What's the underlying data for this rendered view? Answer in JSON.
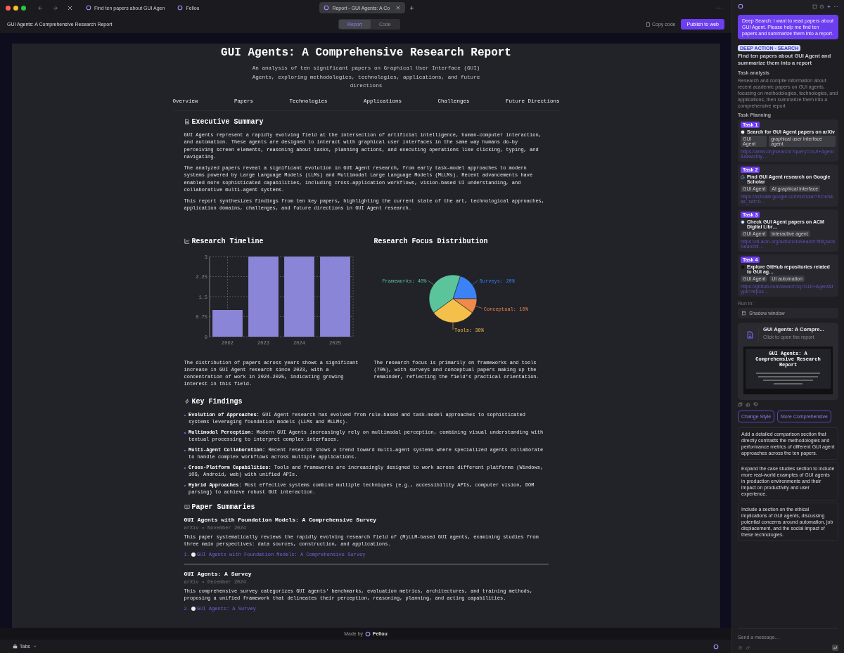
{
  "browser": {
    "tabs": [
      {
        "title": "Find ten papers about GUI Agen",
        "selected": false
      },
      {
        "title": "Fellou",
        "selected": false
      },
      {
        "title": "Report - GUI Agents: A Co",
        "selected": true
      }
    ],
    "new_tab": "+",
    "more": "···"
  },
  "toolbar": {
    "title": "GUI Agents: A Comprehensive Research Report",
    "views": [
      {
        "label": "Report",
        "selected": true
      },
      {
        "label": "Code",
        "selected": false
      }
    ],
    "copy": "Copy code",
    "publish": "Publish to web"
  },
  "report": {
    "title": "GUI Agents: A Comprehensive Research Report",
    "subtitle": "An analysis of ten significant papers on Graphical User Interface (GUI) Agents, exploring methodologies, technologies, applications, and future directions",
    "nav": [
      "Overview",
      "Papers",
      "Technologies",
      "Applications",
      "Challenges",
      "Future Directions"
    ],
    "summary": {
      "heading": "Executive Summary",
      "paragraphs": [
        "GUI Agents represent a rapidly evolving field at the intersection of artificial intelligence, human-computer interaction, and automation. These agents are designed to interact with graphical user interfaces in the same way humans do-by perceiving screen elements, reasoning about tasks, planning actions, and executing operations like clicking, typing, and navigating.",
        "The analyzed papers reveal a significant evolution in GUI Agent research, from early task-model approaches to modern systems powered by Large Language Models (LLMs) and Multimodal Large Language Models (MLLMs). Recent advancements have enabled more sophisticated capabilities, including cross-application workflows, vision-based UI understanding, and collaborative multi-agent systems.",
        "This report synthesizes findings from ten key papers, highlighting the current state of the art, technological approaches, application domains, challenges, and future directions in GUI Agent research."
      ]
    },
    "timeline": {
      "heading": "Research Timeline",
      "chart_data": {
        "type": "bar",
        "categories": [
          "2002",
          "2023",
          "2024",
          "2025"
        ],
        "values": [
          1,
          3,
          3,
          3
        ],
        "ylim": [
          0,
          3
        ],
        "yticks": [
          0,
          0.75,
          1.5,
          2.25,
          3
        ],
        "grid": true
      },
      "caption": "The distribution of papers across years shows a significant increase in GUI Agent research since 2023, with a concentration of work in 2024-2025, indicating growing interest in this field."
    },
    "focus": {
      "heading": "Research Focus Distribution",
      "chart_data": {
        "type": "pie",
        "values": [
          20,
          10,
          30,
          40
        ],
        "colors": [
          "#3b82f6",
          "#f08a4b",
          "#f5c04a",
          "#5cc49b"
        ],
        "value_labels": [
          "Surveys: 20%",
          "Conceptual: 10%",
          "Tools: 30%",
          "Frameworks: 40%"
        ]
      },
      "caption": "The research focus is primarily on frameworks and tools (70%), with surveys and conceptual papers making up the remainder, reflecting the field's practical orientation."
    },
    "findings": {
      "heading": "Key Findings",
      "items": [
        "**Evolution of Approaches:** GUI Agent research has evolved from rule-based and task-model approaches to sophisticated systems leveraging foundation models (LLMs and MLLMs).",
        "**Multimodal Perception:** Modern GUI Agents increasingly rely on multimodal perception, combining visual understanding with textual processing to interpret complex interfaces.",
        "**Multi-Agent Collaboration:** Recent research shows a trend toward multi-agent systems where specialized agents collaborate to handle complex workflows across multiple applications.",
        "**Cross-Platform Capabilities:** Tools and frameworks are increasingly designed to work across different platforms (Windows, iOS, Android, web) with unified APIs.",
        "**Hybrid Approaches:** Most effective systems combine multiple techniques (e.g., accessibility APIs, computer vision, DOM parsing) to achieve robust GUI interaction."
      ]
    },
    "papers": {
      "heading": "Paper Summaries",
      "items": [
        {
          "title": "GUI Agents with Foundation Models: A Comprehensive Survey",
          "meta": "arXiv • November 2024",
          "description": "This paper systematically reviews the rapidly evolving research field of (M)LLM-based GUI agents, examining studies from three main perspectives: data sources, construction, and applications.",
          "number": "1.",
          "link": "GUI Agents with Foundation Models: A Comprehensive Survey"
        },
        {
          "title": "GUI Agents: A Survey",
          "meta": "arXiv • December 2024",
          "description": "This comprehensive survey categorizes GUI agents' benchmarks, evaluation metrics, architectures, and training methods, proposing a unified framework that delineates their perception, reasoning, planning, and acting capabilities.",
          "number": "2.",
          "link": "GUI Agents: A Survey"
        }
      ]
    }
  },
  "footer": {
    "made_by": "Made by",
    "brand": "Fellou"
  },
  "bottom_bar": {
    "tabs": "Tabs"
  },
  "chat": {
    "user_message": "Deep Search: I want to read papers about GUI Agent. Please help me find ten papers and summarize them into a report.",
    "badge": "DEEP ACTION - SEARCH",
    "heading": "Find ten papers about GUI Agent and summarize them into a report",
    "analysis_label": "Task analysis",
    "analysis": "Research and compile information about recent academic papers on GUI agents, focusing on methodologies, technologies, and applications, then summarize them into a comprehensive report",
    "planning_label": "Task Planning",
    "tasks": [
      {
        "badge": "Task 1",
        "kind": "light",
        "title": "Search for GUI Agent papers on arXiv",
        "tags": [
          "GUI Agent",
          "graphical user interface agent"
        ],
        "url": "https://arxiv.org/search/?query=GUI+Agent&searchty…"
      },
      {
        "badge": "Task 2",
        "kind": "ring",
        "title": "Find GUI Agent research on Google Scholar",
        "tags": [
          "GUI Agent",
          "AI graphical interface"
        ],
        "url": "https://scholar.google.com/scholar?hl=en&as_sdt=0…"
      },
      {
        "badge": "Task 3",
        "kind": "blue",
        "title": "Check GUI Agent papers on ACM Digital Libr…",
        "tags": [
          "GUI Agent",
          "interactive agent"
        ],
        "url": "https://dl.acm.org/action/doSearch?fillQuickSearchfi…"
      },
      {
        "badge": "Task 4",
        "kind": "dark",
        "title": "Explore GitHub repositories related to GUI ag…",
        "tags": [
          "GUI Agent",
          "UI automation"
        ],
        "url": "https://github.com/search?q=GUI+Agent&type=repos…"
      }
    ],
    "run_in_label": "Run in:",
    "run_in": "Shadow window",
    "report_card": {
      "title": "GUI Agents: A Compre...",
      "hint": "Click to open the report",
      "preview": {
        "title": "GUI Agents: A Comprehensive Research Report"
      }
    },
    "actions": [
      "Change Style",
      "More Comprehensive"
    ],
    "suggestions": [
      "Add a detailed comparison section that directly contrasts the methodologies and performance metrics of different GUI agent approaches across the ten papers.",
      "Expand the case studies section to include more real-world examples of GUI agents in production environments and their impact on productivity and user experience.",
      "Include a section on the ethical implications of GUI agents, discussing potential concerns around automation, job displacement, and the social impact of these technologies."
    ],
    "input": {
      "placeholder": "Send a message..."
    }
  }
}
